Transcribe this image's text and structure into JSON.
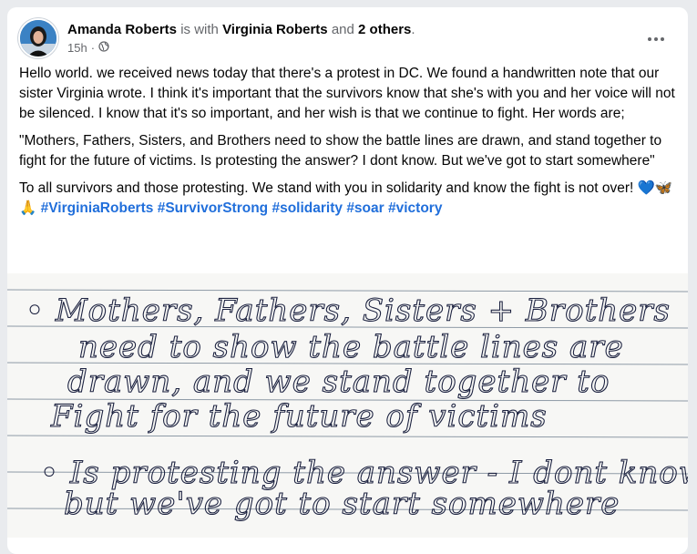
{
  "post": {
    "author": "Amanda Roberts",
    "with_text": "is with",
    "tagged_person": "Virginia Roberts",
    "and_text": "and",
    "others": "2 others",
    "period": ".",
    "timestamp": "15h",
    "separator": "·",
    "privacy_icon": "globe-icon",
    "more_icon": "more-horizontal-icon",
    "paragraphs": [
      "Hello world. we received news today that there's a protest in DC. We found a handwritten note that our sister Virginia wrote. I think it's important that the survivors know that she's with you and her voice will not be silenced. I know that it's so important, and her wish is that we continue to fight. Her words are;",
      "\"Mothers, Fathers, Sisters, and Brothers need to show the battle lines are drawn, and stand together to fight for the future of victims. Is protesting the answer? I dont know. But we've got to start somewhere\""
    ],
    "closing_text": "To all survivors and those protesting. We stand with you in solidarity and know the fight is not over!",
    "emojis": "💙🦋🙏",
    "hashtags": [
      "#VirginiaRoberts",
      "#SurvivorStrong",
      "#solidarity",
      "#soar",
      "#victory"
    ]
  },
  "note": {
    "lines": [
      "• Mothers, Fathers, Sisters + Brothers",
      "need to show the battle lines are",
      "drawn, and we stand together to",
      "Fight for the future of victims",
      "• Is protesting the answer - I dont know",
      "but we've got to start somewhere"
    ]
  },
  "colors": {
    "hashtag": "#216fdb",
    "muted": "#65676b",
    "ink": "#1c2240",
    "ruled_line": "#8e9aa6"
  }
}
